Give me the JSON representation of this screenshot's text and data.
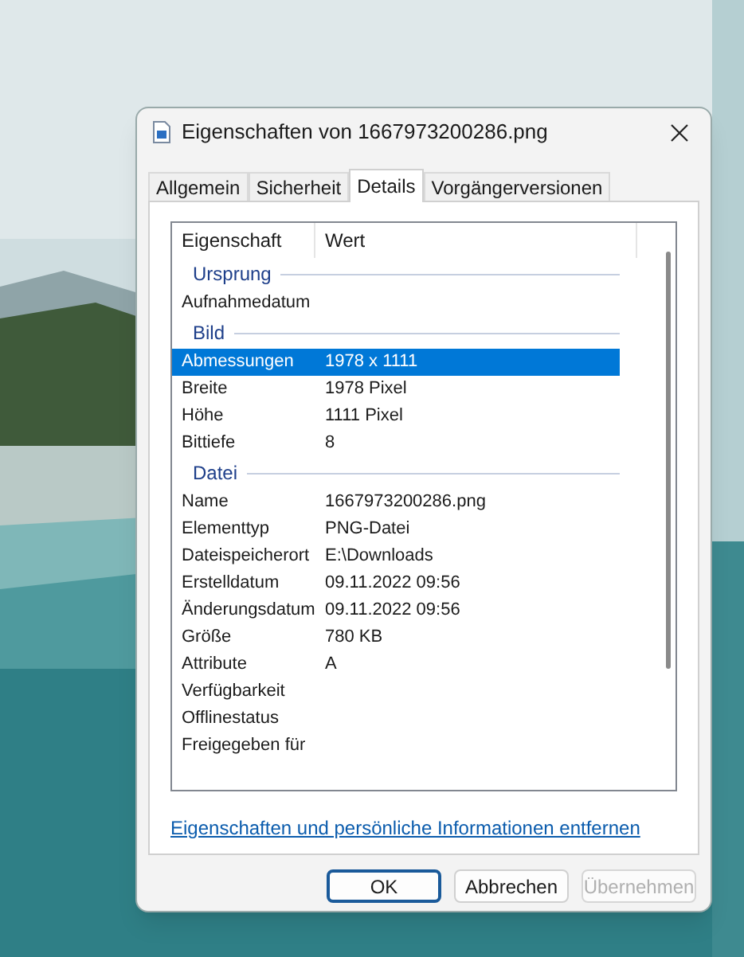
{
  "window": {
    "title": "Eigenschaften von 1667973200286.png"
  },
  "tabs": [
    {
      "label": "Allgemein",
      "selected": false
    },
    {
      "label": "Sicherheit",
      "selected": false
    },
    {
      "label": "Details",
      "selected": true
    },
    {
      "label": "Vorgängerversionen",
      "selected": false
    }
  ],
  "table": {
    "columns": [
      "Eigenschaft",
      "Wert"
    ],
    "groups": [
      {
        "title": "Ursprung",
        "rows": [
          {
            "property": "Aufnahmedatum",
            "selected": false
          }
        ]
      },
      {
        "title": "Bild",
        "rows": [
          {
            "property": "Abmessungen",
            "value": "1978 x 1111",
            "selected": true
          },
          {
            "property": "Breite",
            "value": "1978 Pixel",
            "selected": false
          },
          {
            "property": "Höhe",
            "value": "1111 Pixel",
            "selected": false
          },
          {
            "property": "Bittiefe",
            "value": "8",
            "selected": false
          }
        ]
      },
      {
        "title": "Datei",
        "rows": [
          {
            "property": "Name",
            "value": "1667973200286.png",
            "selected": false
          },
          {
            "property": "Elementtyp",
            "value": "PNG-Datei",
            "selected": false
          },
          {
            "property": "Dateispeicherort",
            "value": "E:\\Downloads",
            "selected": false
          },
          {
            "property": "Erstelldatum",
            "value": "09.11.2022 09:56",
            "selected": false
          },
          {
            "property": "Änderungsdatum",
            "value": "09.11.2022 09:56",
            "selected": false
          },
          {
            "property": "Größe",
            "value": "780 KB",
            "selected": false
          },
          {
            "property": "Attribute",
            "value": "A",
            "selected": false
          },
          {
            "property": "Verfügbarkeit",
            "selected": false
          },
          {
            "property": "Offlinestatus",
            "selected": false
          },
          {
            "property": "Freigegeben für",
            "selected": false
          }
        ]
      }
    ]
  },
  "link": "Eigenschaften und persönliche Informationen entfernen",
  "buttons": [
    {
      "label": "OK",
      "kind": "default",
      "disabled": false
    },
    {
      "label": "Abbrechen",
      "kind": "normal",
      "disabled": false
    },
    {
      "label": "Übernehmen",
      "kind": "normal",
      "disabled": true
    }
  ]
}
